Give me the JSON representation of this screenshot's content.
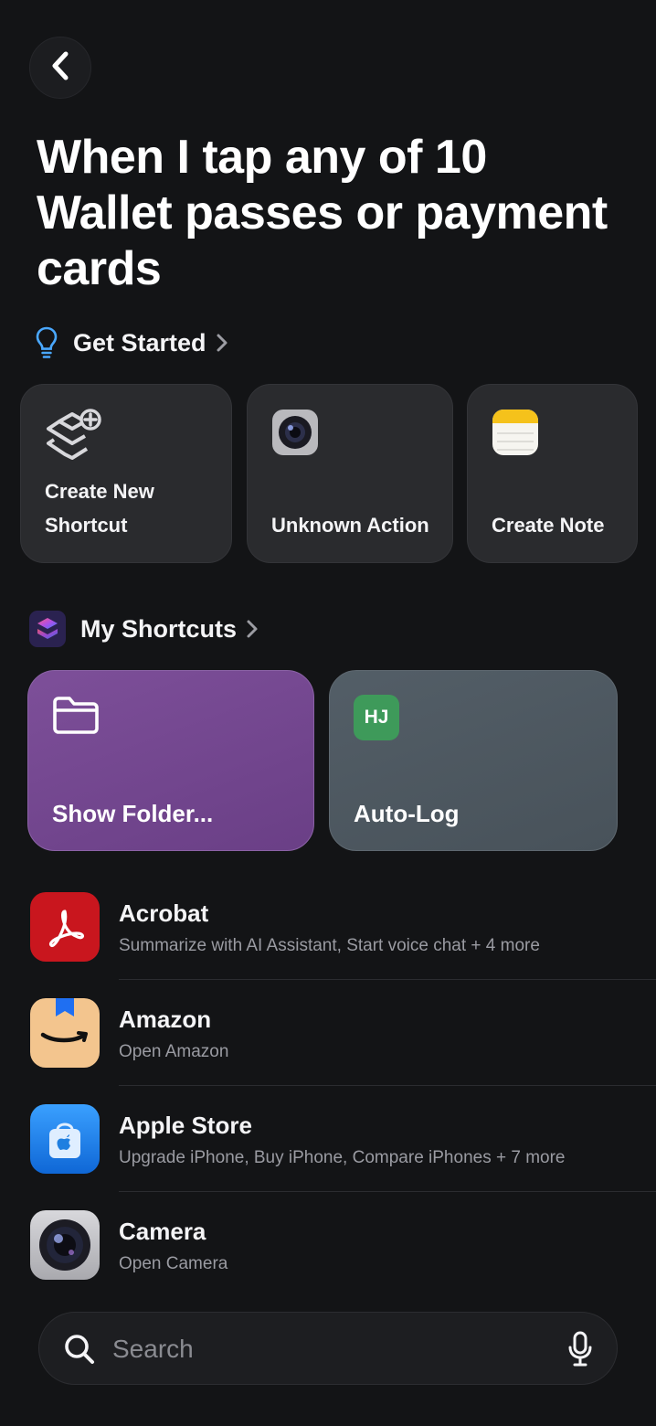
{
  "header": {
    "back_icon": "chevron-left-icon",
    "title": "When I tap any of 10 Wallet passes or payment cards"
  },
  "get_started": {
    "label": "Get Started",
    "icon": "lightbulb-icon",
    "accent": "#4aa8ff",
    "actions": [
      {
        "label": "Create New Shortcut",
        "icon": "shortcuts-plus-icon"
      },
      {
        "label": "Unknown Action",
        "icon": "camera-lens-icon"
      },
      {
        "label": "Create Note",
        "icon": "notes-icon"
      }
    ]
  },
  "my_shortcuts": {
    "label": "My Shortcuts",
    "icon": "shortcuts-app-icon",
    "tiles": [
      {
        "label": "Show Folder...",
        "icon": "folder-icon",
        "color": "#744896"
      },
      {
        "label": "Auto-Log",
        "icon": "hj-badge-icon",
        "badge": "HJ",
        "color": "#4e5860"
      }
    ]
  },
  "apps": [
    {
      "name": "Acrobat",
      "subtitle": "Summarize with AI Assistant, Start voice chat + 4 more",
      "icon": "acrobat-icon",
      "color": "#c9161e"
    },
    {
      "name": "Amazon",
      "subtitle": "Open Amazon",
      "icon": "amazon-icon",
      "color": "#f3c58e"
    },
    {
      "name": "Apple Store",
      "subtitle": "Upgrade iPhone, Buy iPhone, Compare iPhones + 7 more",
      "icon": "apple-store-icon",
      "color": "#1f7fe0"
    },
    {
      "name": "Camera",
      "subtitle": "Open Camera",
      "icon": "camera-icon",
      "color": "#c8c8cc"
    }
  ],
  "search": {
    "placeholder": "Search",
    "search_icon": "magnifier-icon",
    "mic_icon": "microphone-icon"
  }
}
